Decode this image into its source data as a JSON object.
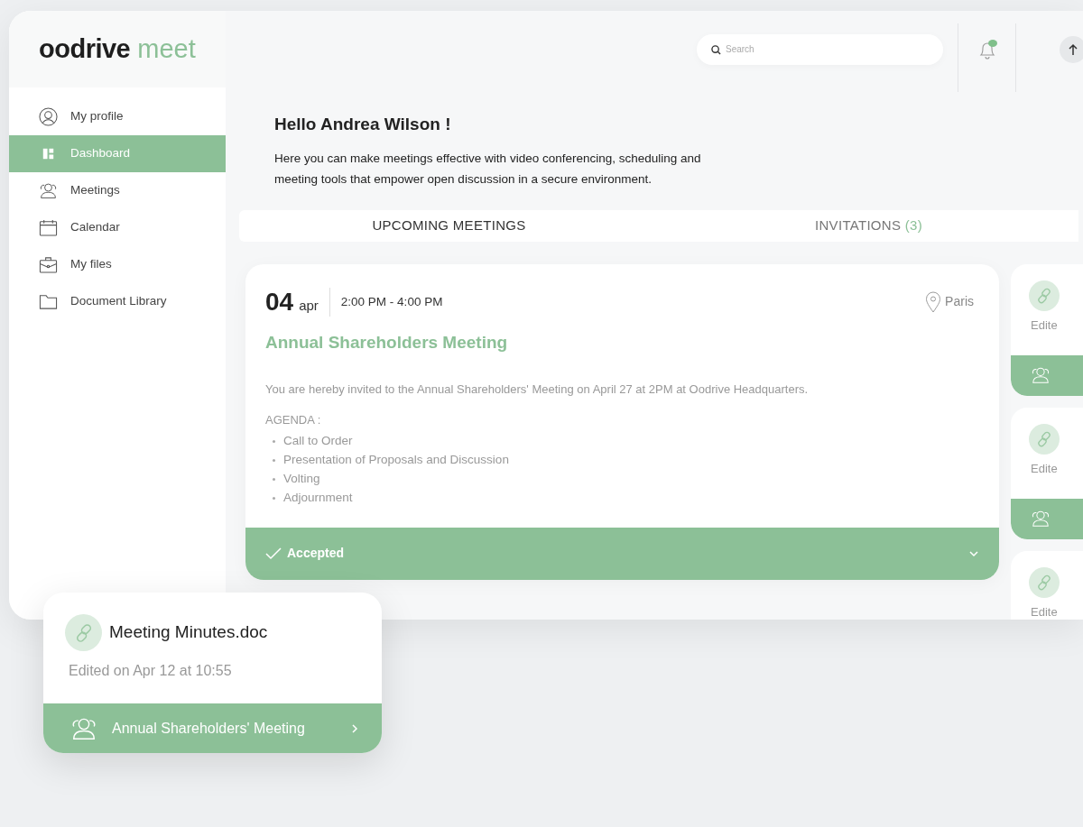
{
  "logo": {
    "brand": "oodrive",
    "product": "meet"
  },
  "sidebar": {
    "items": [
      {
        "label": "My profile",
        "selected": false
      },
      {
        "label": "Dashboard",
        "selected": true
      },
      {
        "label": "Meetings",
        "selected": false
      },
      {
        "label": "Calendar",
        "selected": false
      },
      {
        "label": "My files",
        "selected": false
      },
      {
        "label": "Document Library",
        "selected": false
      }
    ]
  },
  "search": {
    "placeholder": "Search"
  },
  "greeting": {
    "title": "Hello Andrea Wilson !",
    "text": "Here you can make meetings effective with video conferencing, scheduling and meeting tools that empower open discussion in a secure environment."
  },
  "tabs": [
    {
      "label": "UPCOMING MEETINGS",
      "selected": true
    },
    {
      "label": "INVITATIONS",
      "count": "(3)",
      "selected": false
    }
  ],
  "meeting": {
    "day": "04",
    "month": "apr",
    "time": "2:00 PM - 4:00 PM",
    "location": "Paris",
    "title": "Annual Shareholders Meeting",
    "description": "You are hereby invited to the Annual Shareholders' Meeting on April 27 at 2PM at Oodrive Headquarters.",
    "agenda_label": "AGENDA :",
    "agenda": [
      "Call to Order",
      "Presentation of Proposals and Discussion",
      "Volting",
      "Adjournment"
    ],
    "status": "Accepted"
  },
  "side_cards": [
    {
      "caption": "Edite"
    },
    {
      "caption": "Edite"
    },
    {
      "caption": "Edite"
    }
  ],
  "file_card": {
    "name": "Meeting Minutes.doc",
    "edited": "Edited on Apr 12 at 10:55",
    "meeting": "Annual Shareholders' Meeting"
  }
}
